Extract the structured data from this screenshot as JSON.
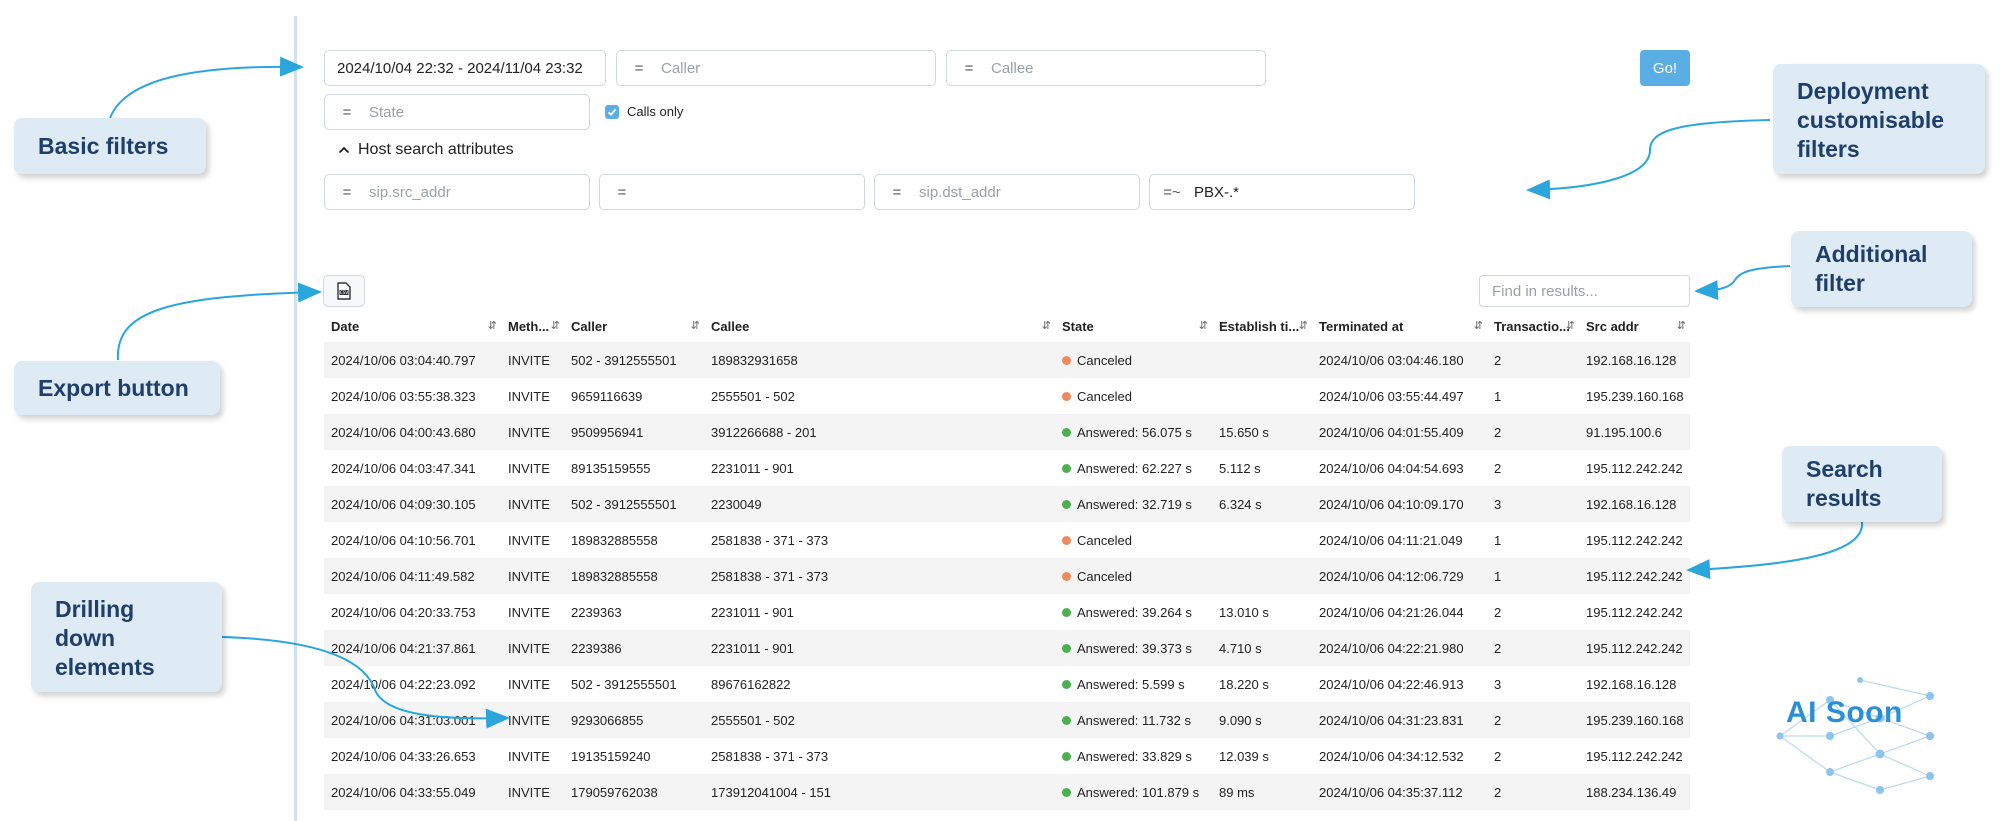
{
  "filters": {
    "date_range": "2024/10/04 22:32 - 2024/11/04 23:32",
    "caller": {
      "op": "=",
      "placeholder": "Caller"
    },
    "callee": {
      "op": "=",
      "placeholder": "Callee"
    },
    "state": {
      "op": "=",
      "placeholder": "State"
    },
    "calls_only_label": "Calls only",
    "calls_only_checked": true,
    "go_label": "Go!",
    "host_search_label": "Host search attributes",
    "host_fields": [
      {
        "op": "=",
        "placeholder": "sip.src_addr",
        "value": ""
      },
      {
        "op": "=",
        "placeholder": "",
        "value": ""
      },
      {
        "op": "=",
        "placeholder": "sip.dst_addr",
        "value": ""
      },
      {
        "op": "=~",
        "placeholder": "",
        "value": "PBX-.*"
      }
    ]
  },
  "toolbar": {
    "export_icon": "csv-file-icon",
    "find_placeholder": "Find in results..."
  },
  "table": {
    "columns": [
      "Date",
      "Meth...",
      "Caller",
      "Callee",
      "State",
      "Establish ti...",
      "Terminated at",
      "Transactio...",
      "Src addr"
    ],
    "rows": [
      {
        "date": "2024/10/06 03:04:40.797",
        "method": "INVITE",
        "caller": "502 - 3912555501",
        "callee": "189832931658",
        "state": "Canceled",
        "state_kind": "canceled",
        "establish": "",
        "terminated": "2024/10/06 03:04:46.180",
        "transactions": "2",
        "src": "192.168.16.128"
      },
      {
        "date": "2024/10/06 03:55:38.323",
        "method": "INVITE",
        "caller": "9659116639",
        "callee": "2555501 - 502",
        "state": "Canceled",
        "state_kind": "canceled",
        "establish": "",
        "terminated": "2024/10/06 03:55:44.497",
        "transactions": "1",
        "src": "195.239.160.168"
      },
      {
        "date": "2024/10/06 04:00:43.680",
        "method": "INVITE",
        "caller": "9509956941",
        "callee": "3912266688 - 201",
        "state": "Answered: 56.075 s",
        "state_kind": "answered",
        "establish": "15.650 s",
        "terminated": "2024/10/06 04:01:55.409",
        "transactions": "2",
        "src": "91.195.100.6"
      },
      {
        "date": "2024/10/06 04:03:47.341",
        "method": "INVITE",
        "caller": "89135159555",
        "callee": "2231011 - 901",
        "state": "Answered: 62.227 s",
        "state_kind": "answered",
        "establish": "5.112 s",
        "terminated": "2024/10/06 04:04:54.693",
        "transactions": "2",
        "src": "195.112.242.242"
      },
      {
        "date": "2024/10/06 04:09:30.105",
        "method": "INVITE",
        "caller": "502 - 3912555501",
        "callee": "2230049",
        "state": "Answered: 32.719 s",
        "state_kind": "answered",
        "establish": "6.324 s",
        "terminated": "2024/10/06 04:10:09.170",
        "transactions": "3",
        "src": "192.168.16.128"
      },
      {
        "date": "2024/10/06 04:10:56.701",
        "method": "INVITE",
        "caller": "189832885558",
        "callee": "2581838 - 371 - 373",
        "state": "Canceled",
        "state_kind": "canceled",
        "establish": "",
        "terminated": "2024/10/06 04:11:21.049",
        "transactions": "1",
        "src": "195.112.242.242"
      },
      {
        "date": "2024/10/06 04:11:49.582",
        "method": "INVITE",
        "caller": "189832885558",
        "callee": "2581838 - 371 - 373",
        "state": "Canceled",
        "state_kind": "canceled",
        "establish": "",
        "terminated": "2024/10/06 04:12:06.729",
        "transactions": "1",
        "src": "195.112.242.242"
      },
      {
        "date": "2024/10/06 04:20:33.753",
        "method": "INVITE",
        "caller": "2239363",
        "callee": "2231011 - 901",
        "state": "Answered: 39.264 s",
        "state_kind": "answered",
        "establish": "13.010 s",
        "terminated": "2024/10/06 04:21:26.044",
        "transactions": "2",
        "src": "195.112.242.242"
      },
      {
        "date": "2024/10/06 04:21:37.861",
        "method": "INVITE",
        "caller": "2239386",
        "callee": "2231011 - 901",
        "state": "Answered: 39.373 s",
        "state_kind": "answered",
        "establish": "4.710 s",
        "terminated": "2024/10/06 04:22:21.980",
        "transactions": "2",
        "src": "195.112.242.242"
      },
      {
        "date": "2024/10/06 04:22:23.092",
        "method": "INVITE",
        "caller": "502 - 3912555501",
        "callee": "89676162822",
        "state": "Answered: 5.599 s",
        "state_kind": "answered",
        "establish": "18.220 s",
        "terminated": "2024/10/06 04:22:46.913",
        "transactions": "3",
        "src": "192.168.16.128"
      },
      {
        "date": "2024/10/06 04:31:03.001",
        "method": "INVITE",
        "caller": "9293066855",
        "callee": "2555501 - 502",
        "state": "Answered: 11.732 s",
        "state_kind": "answered",
        "establish": "9.090 s",
        "terminated": "2024/10/06 04:31:23.831",
        "transactions": "2",
        "src": "195.239.160.168"
      },
      {
        "date": "2024/10/06 04:33:26.653",
        "method": "INVITE",
        "caller": "19135159240",
        "callee": "2581838 - 371 - 373",
        "state": "Answered: 33.829 s",
        "state_kind": "answered",
        "establish": "12.039 s",
        "terminated": "2024/10/06 04:34:12.532",
        "transactions": "2",
        "src": "195.112.242.242"
      },
      {
        "date": "2024/10/06 04:33:55.049",
        "method": "INVITE",
        "caller": "179059762038",
        "callee": "173912041004 - 151",
        "state": "Answered: 101.879 s",
        "state_kind": "answered",
        "establish": "89 ms",
        "terminated": "2024/10/06 04:35:37.112",
        "transactions": "2",
        "src": "188.234.136.49"
      }
    ]
  },
  "state_colors": {
    "canceled": "#f08a5d",
    "answered": "#4caf50"
  },
  "callouts": {
    "basic_filters": "Basic filters",
    "deployment": [
      "Deployment",
      "customisable",
      "filters"
    ],
    "additional": [
      "Additional",
      "filter"
    ],
    "export": "Export button",
    "search_results": [
      "Search",
      "results"
    ],
    "drilling": [
      "Drilling",
      "down",
      "elements"
    ]
  },
  "branding": {
    "ai_soon": "AI Soon"
  },
  "colors": {
    "accent": "#5aaee3",
    "callout_bg": "#deebf5",
    "callout_text": "#1f3f6a",
    "arrow": "#2aa6dd"
  }
}
